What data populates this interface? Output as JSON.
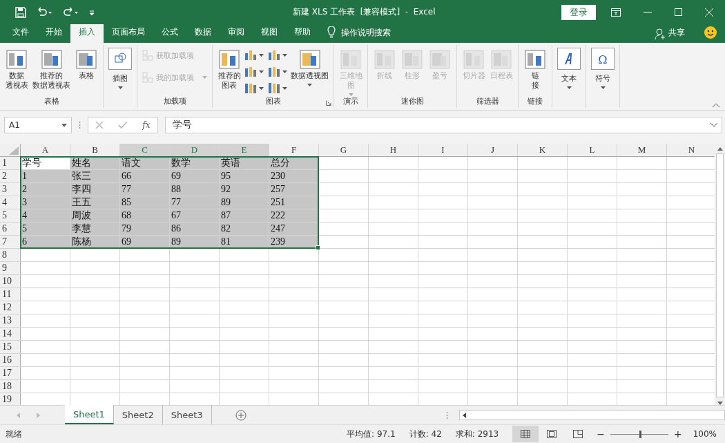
{
  "title_bar": {
    "title": "新建 XLS 工作表  [兼容模式]  -  Excel",
    "sign_in": "登录"
  },
  "menu_tabs": [
    {
      "label": "文件",
      "selected": false
    },
    {
      "label": "开始",
      "selected": false
    },
    {
      "label": "插入",
      "selected": true
    },
    {
      "label": "页面布局",
      "selected": false
    },
    {
      "label": "公式",
      "selected": false
    },
    {
      "label": "数据",
      "selected": false
    },
    {
      "label": "审阅",
      "selected": false
    },
    {
      "label": "视图",
      "selected": false
    },
    {
      "label": "帮助",
      "selected": false
    }
  ],
  "tell_me": "操作说明搜索",
  "share": "共享",
  "ribbon": [
    {
      "label": "表格",
      "buttons": [
        {
          "kind": "large",
          "lines": [
            "数据",
            "透视表"
          ],
          "disabled": false,
          "dropdown": false
        },
        {
          "kind": "large",
          "lines": [
            "推荐的",
            "数据透视表"
          ],
          "disabled": false,
          "dropdown": false
        },
        {
          "kind": "large",
          "lines": [
            "表格"
          ],
          "disabled": false,
          "dropdown": false
        }
      ]
    },
    {
      "buttons": [
        {
          "kind": "boxed",
          "lines": [
            "插图"
          ],
          "disabled": false,
          "dropdown": true
        }
      ]
    },
    {
      "label": "加载项",
      "buttons": [
        {
          "kind": "small",
          "lines": [
            "获取加载项"
          ],
          "disabled": true,
          "dropdown": false
        },
        {
          "kind": "small",
          "lines": [
            "我的加载项"
          ],
          "disabled": true,
          "dropdown": true
        }
      ]
    },
    {
      "label": "图表",
      "launcher": true,
      "buttons": [
        {
          "kind": "large",
          "lines": [
            "推荐的",
            "图表"
          ],
          "disabled": false,
          "dropdown": false
        },
        {
          "kind": "chartgrid"
        },
        {
          "kind": "large",
          "lines": [
            "数据透视图"
          ],
          "disabled": false,
          "dropdown": true
        }
      ]
    },
    {
      "label": "演示",
      "buttons": [
        {
          "kind": "large",
          "lines": [
            "三维地",
            "图"
          ],
          "disabled": true,
          "dropdown": true
        }
      ]
    },
    {
      "label": "迷你图",
      "buttons": [
        {
          "kind": "large",
          "lines": [
            "折线"
          ],
          "disabled": true,
          "dropdown": false
        },
        {
          "kind": "large",
          "lines": [
            "柱形"
          ],
          "disabled": true,
          "dropdown": false
        },
        {
          "kind": "large",
          "lines": [
            "盈亏"
          ],
          "disabled": true,
          "dropdown": false
        }
      ]
    },
    {
      "label": "筛选器",
      "buttons": [
        {
          "kind": "large",
          "lines": [
            "切片器"
          ],
          "disabled": true,
          "dropdown": false
        },
        {
          "kind": "large",
          "lines": [
            "日程表"
          ],
          "disabled": true,
          "dropdown": false
        }
      ]
    },
    {
      "label": "链接",
      "buttons": [
        {
          "kind": "large",
          "lines": [
            "链",
            "接"
          ],
          "disabled": false,
          "dropdown": false
        }
      ]
    },
    {
      "buttons": [
        {
          "kind": "boxed",
          "lines": [
            "文本"
          ],
          "disabled": false,
          "dropdown": true
        }
      ]
    },
    {
      "buttons": [
        {
          "kind": "boxed",
          "glyph": "Ω",
          "lines": [
            "符号"
          ],
          "disabled": false,
          "dropdown": true
        }
      ]
    }
  ],
  "formula_bar": {
    "name_box": "A1",
    "insert_function": "fx",
    "formula": "学号"
  },
  "grid": {
    "columns": [
      {
        "label": "A",
        "selected": false
      },
      {
        "label": "B",
        "selected": false
      },
      {
        "label": "C",
        "selected": true
      },
      {
        "label": "D",
        "selected": true
      },
      {
        "label": "E",
        "selected": true
      },
      {
        "label": "F",
        "selected": false
      },
      {
        "label": "G",
        "selected": false
      },
      {
        "label": "H",
        "selected": false
      },
      {
        "label": "I",
        "selected": false
      },
      {
        "label": "J",
        "selected": false
      },
      {
        "label": "K",
        "selected": false
      },
      {
        "label": "L",
        "selected": false
      },
      {
        "label": "M",
        "selected": false
      },
      {
        "label": "N",
        "selected": false
      }
    ],
    "rows": [
      {
        "number": "1",
        "cells": [
          {
            "text": "学号",
            "selected": false
          },
          {
            "text": "姓名",
            "selected": true
          },
          {
            "text": "语文",
            "selected": true
          },
          {
            "text": "数学",
            "selected": true
          },
          {
            "text": "英语",
            "selected": true
          },
          {
            "text": "总分",
            "selected": true
          }
        ]
      },
      {
        "number": "2",
        "cells": [
          {
            "text": "1",
            "selected": true
          },
          {
            "text": "张三",
            "selected": true
          },
          {
            "text": "66",
            "selected": true
          },
          {
            "text": "69",
            "selected": true
          },
          {
            "text": "95",
            "selected": true
          },
          {
            "text": "230",
            "selected": true
          }
        ]
      },
      {
        "number": "3",
        "cells": [
          {
            "text": "2",
            "selected": true
          },
          {
            "text": "李四",
            "selected": true
          },
          {
            "text": "77",
            "selected": true
          },
          {
            "text": "88",
            "selected": true
          },
          {
            "text": "92",
            "selected": true
          },
          {
            "text": "257",
            "selected": true
          }
        ]
      },
      {
        "number": "4",
        "cells": [
          {
            "text": "3",
            "selected": true
          },
          {
            "text": "王五",
            "selected": true
          },
          {
            "text": "85",
            "selected": true
          },
          {
            "text": "77",
            "selected": true
          },
          {
            "text": "89",
            "selected": true
          },
          {
            "text": "251",
            "selected": true
          }
        ]
      },
      {
        "number": "5",
        "cells": [
          {
            "text": "4",
            "selected": true
          },
          {
            "text": "周波",
            "selected": true
          },
          {
            "text": "68",
            "selected": true
          },
          {
            "text": "67",
            "selected": true
          },
          {
            "text": "87",
            "selected": true
          },
          {
            "text": "222",
            "selected": true
          }
        ]
      },
      {
        "number": "6",
        "cells": [
          {
            "text": "5",
            "selected": true
          },
          {
            "text": "李慧",
            "selected": true
          },
          {
            "text": "79",
            "selected": true
          },
          {
            "text": "86",
            "selected": true
          },
          {
            "text": "82",
            "selected": true
          },
          {
            "text": "247",
            "selected": true
          }
        ]
      },
      {
        "number": "7",
        "cells": [
          {
            "text": "6",
            "selected": true
          },
          {
            "text": "陈杨",
            "selected": true
          },
          {
            "text": "69",
            "selected": true
          },
          {
            "text": "89",
            "selected": true
          },
          {
            "text": "81",
            "selected": true
          },
          {
            "text": "239",
            "selected": true
          }
        ]
      },
      {
        "number": "8",
        "cells": []
      },
      {
        "number": "9",
        "cells": []
      },
      {
        "number": "10",
        "cells": []
      },
      {
        "number": "11",
        "cells": []
      },
      {
        "number": "12",
        "cells": []
      },
      {
        "number": "13",
        "cells": []
      },
      {
        "number": "14",
        "cells": []
      },
      {
        "number": "15",
        "cells": []
      },
      {
        "number": "16",
        "cells": []
      },
      {
        "number": "17",
        "cells": []
      },
      {
        "number": "18",
        "cells": []
      },
      {
        "number": "19",
        "cells": []
      }
    ]
  },
  "sheet_tabs": [
    {
      "label": "Sheet1",
      "selected": true
    },
    {
      "label": "Sheet2",
      "selected": false
    },
    {
      "label": "Sheet3",
      "selected": false
    }
  ],
  "status_bar": {
    "status": "就绪",
    "average": "平均值: 97.1",
    "count": "计数: 42",
    "sum": "求和: 2913",
    "views": [
      {
        "selected": true
      },
      {
        "selected": false
      },
      {
        "selected": false
      }
    ],
    "zoom": {
      "minus": "−",
      "plus": "+",
      "level": 0.5,
      "reading": "100%"
    }
  }
}
